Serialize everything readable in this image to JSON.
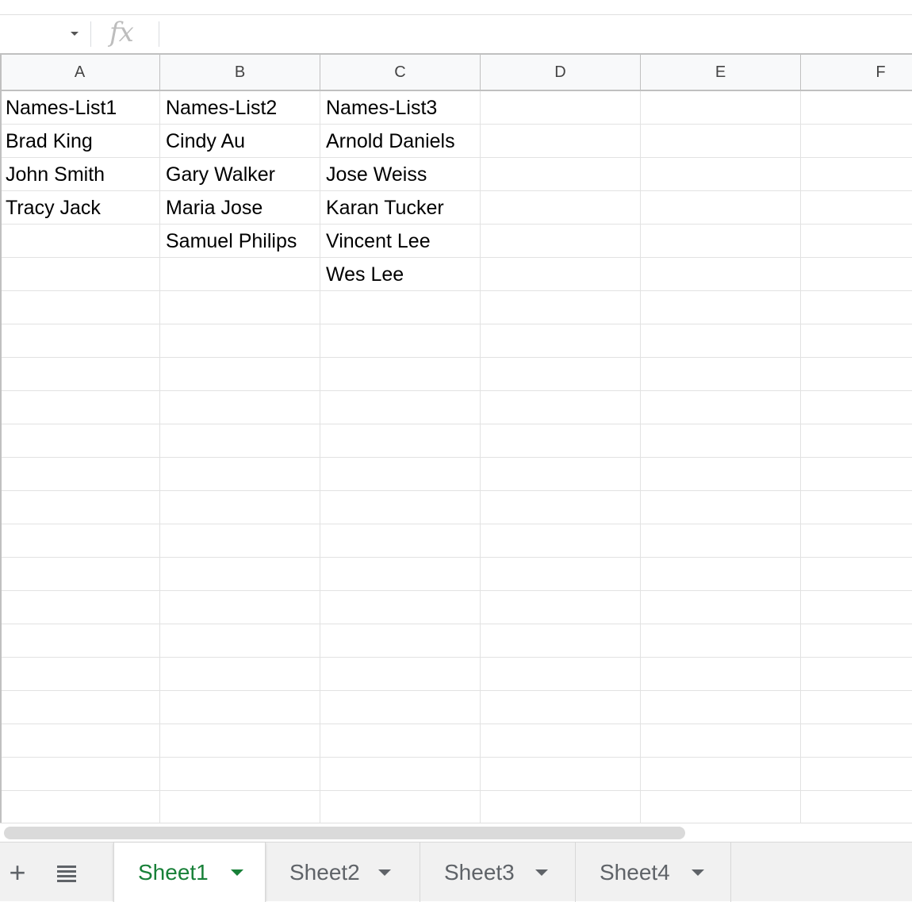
{
  "formula_bar": {
    "fx_label": "fx",
    "name_box_value": "",
    "formula_value": ""
  },
  "columns": [
    "A",
    "B",
    "C",
    "D",
    "E",
    "F"
  ],
  "rows": [
    [
      "Names-List1",
      "Names-List2",
      "Names-List3",
      "",
      "",
      ""
    ],
    [
      "Brad King",
      "Cindy Au",
      "Arnold Daniels",
      "",
      "",
      ""
    ],
    [
      "John Smith",
      "Gary Walker",
      "Jose Weiss",
      "",
      "",
      ""
    ],
    [
      "Tracy Jack",
      "Maria Jose",
      "Karan Tucker",
      "",
      "",
      ""
    ],
    [
      "",
      "Samuel Philips",
      "Vincent Lee",
      "",
      "",
      ""
    ],
    [
      "",
      "",
      "Wes Lee",
      "",
      "",
      ""
    ],
    [
      "",
      "",
      "",
      "",
      "",
      ""
    ],
    [
      "",
      "",
      "",
      "",
      "",
      ""
    ],
    [
      "",
      "",
      "",
      "",
      "",
      ""
    ],
    [
      "",
      "",
      "",
      "",
      "",
      ""
    ],
    [
      "",
      "",
      "",
      "",
      "",
      ""
    ],
    [
      "",
      "",
      "",
      "",
      "",
      ""
    ],
    [
      "",
      "",
      "",
      "",
      "",
      ""
    ],
    [
      "",
      "",
      "",
      "",
      "",
      ""
    ],
    [
      "",
      "",
      "",
      "",
      "",
      ""
    ],
    [
      "",
      "",
      "",
      "",
      "",
      ""
    ],
    [
      "",
      "",
      "",
      "",
      "",
      ""
    ],
    [
      "",
      "",
      "",
      "",
      "",
      ""
    ],
    [
      "",
      "",
      "",
      "",
      "",
      ""
    ],
    [
      "",
      "",
      "",
      "",
      "",
      ""
    ],
    [
      "",
      "",
      "",
      "",
      "",
      ""
    ],
    [
      "",
      "",
      "",
      "",
      "",
      ""
    ]
  ],
  "tabbar": {
    "add_icon": "plus-icon",
    "list_icon": "sheet-list-icon",
    "tabs": [
      {
        "label": "Sheet1",
        "active": true
      },
      {
        "label": "Sheet2",
        "active": false
      },
      {
        "label": "Sheet3",
        "active": false
      },
      {
        "label": "Sheet4",
        "active": false
      }
    ]
  },
  "colors": {
    "active_tab": "#188038",
    "grid_line": "#e2e2e2",
    "header_bg": "#f8f9fa"
  }
}
